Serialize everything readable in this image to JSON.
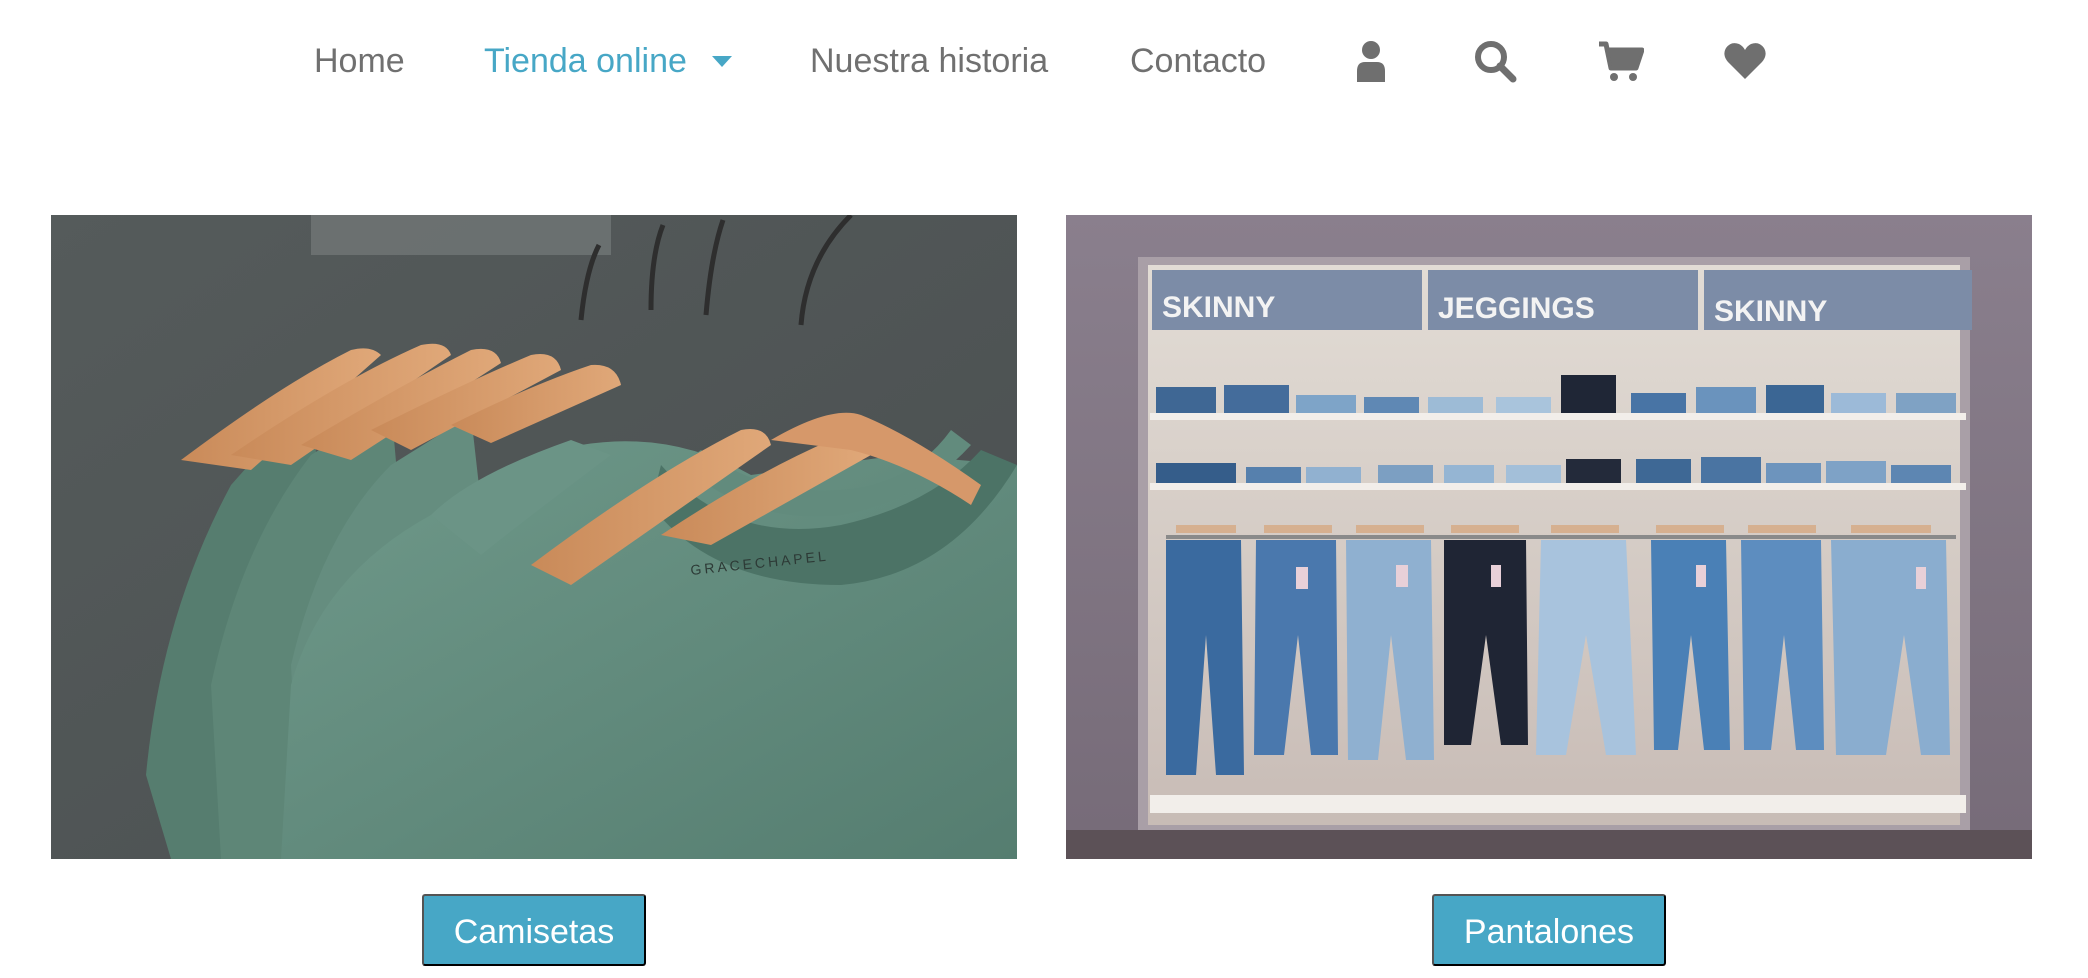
{
  "nav": {
    "items": [
      {
        "label": "Home",
        "active": false
      },
      {
        "label": "Tienda online",
        "active": true,
        "has_dropdown": true
      },
      {
        "label": "Nuestra historia",
        "active": false
      },
      {
        "label": "Contacto",
        "active": false
      }
    ],
    "icons": [
      "user-icon",
      "search-icon",
      "cart-icon",
      "heart-icon"
    ]
  },
  "categories": [
    {
      "label": "Camisetas",
      "image": "green t-shirts on wooden hangers",
      "print_text": "GRACECHAPEL"
    },
    {
      "label": "Pantalones",
      "image": "jeans on shelves and hangers",
      "signs": [
        "SKINNY",
        "JEGGINGS",
        "SKINNY"
      ]
    }
  ],
  "colors": {
    "accent": "#47a7c6",
    "nav_text": "#707070",
    "icon": "#6f6f6f",
    "button_text": "#ffffff"
  }
}
